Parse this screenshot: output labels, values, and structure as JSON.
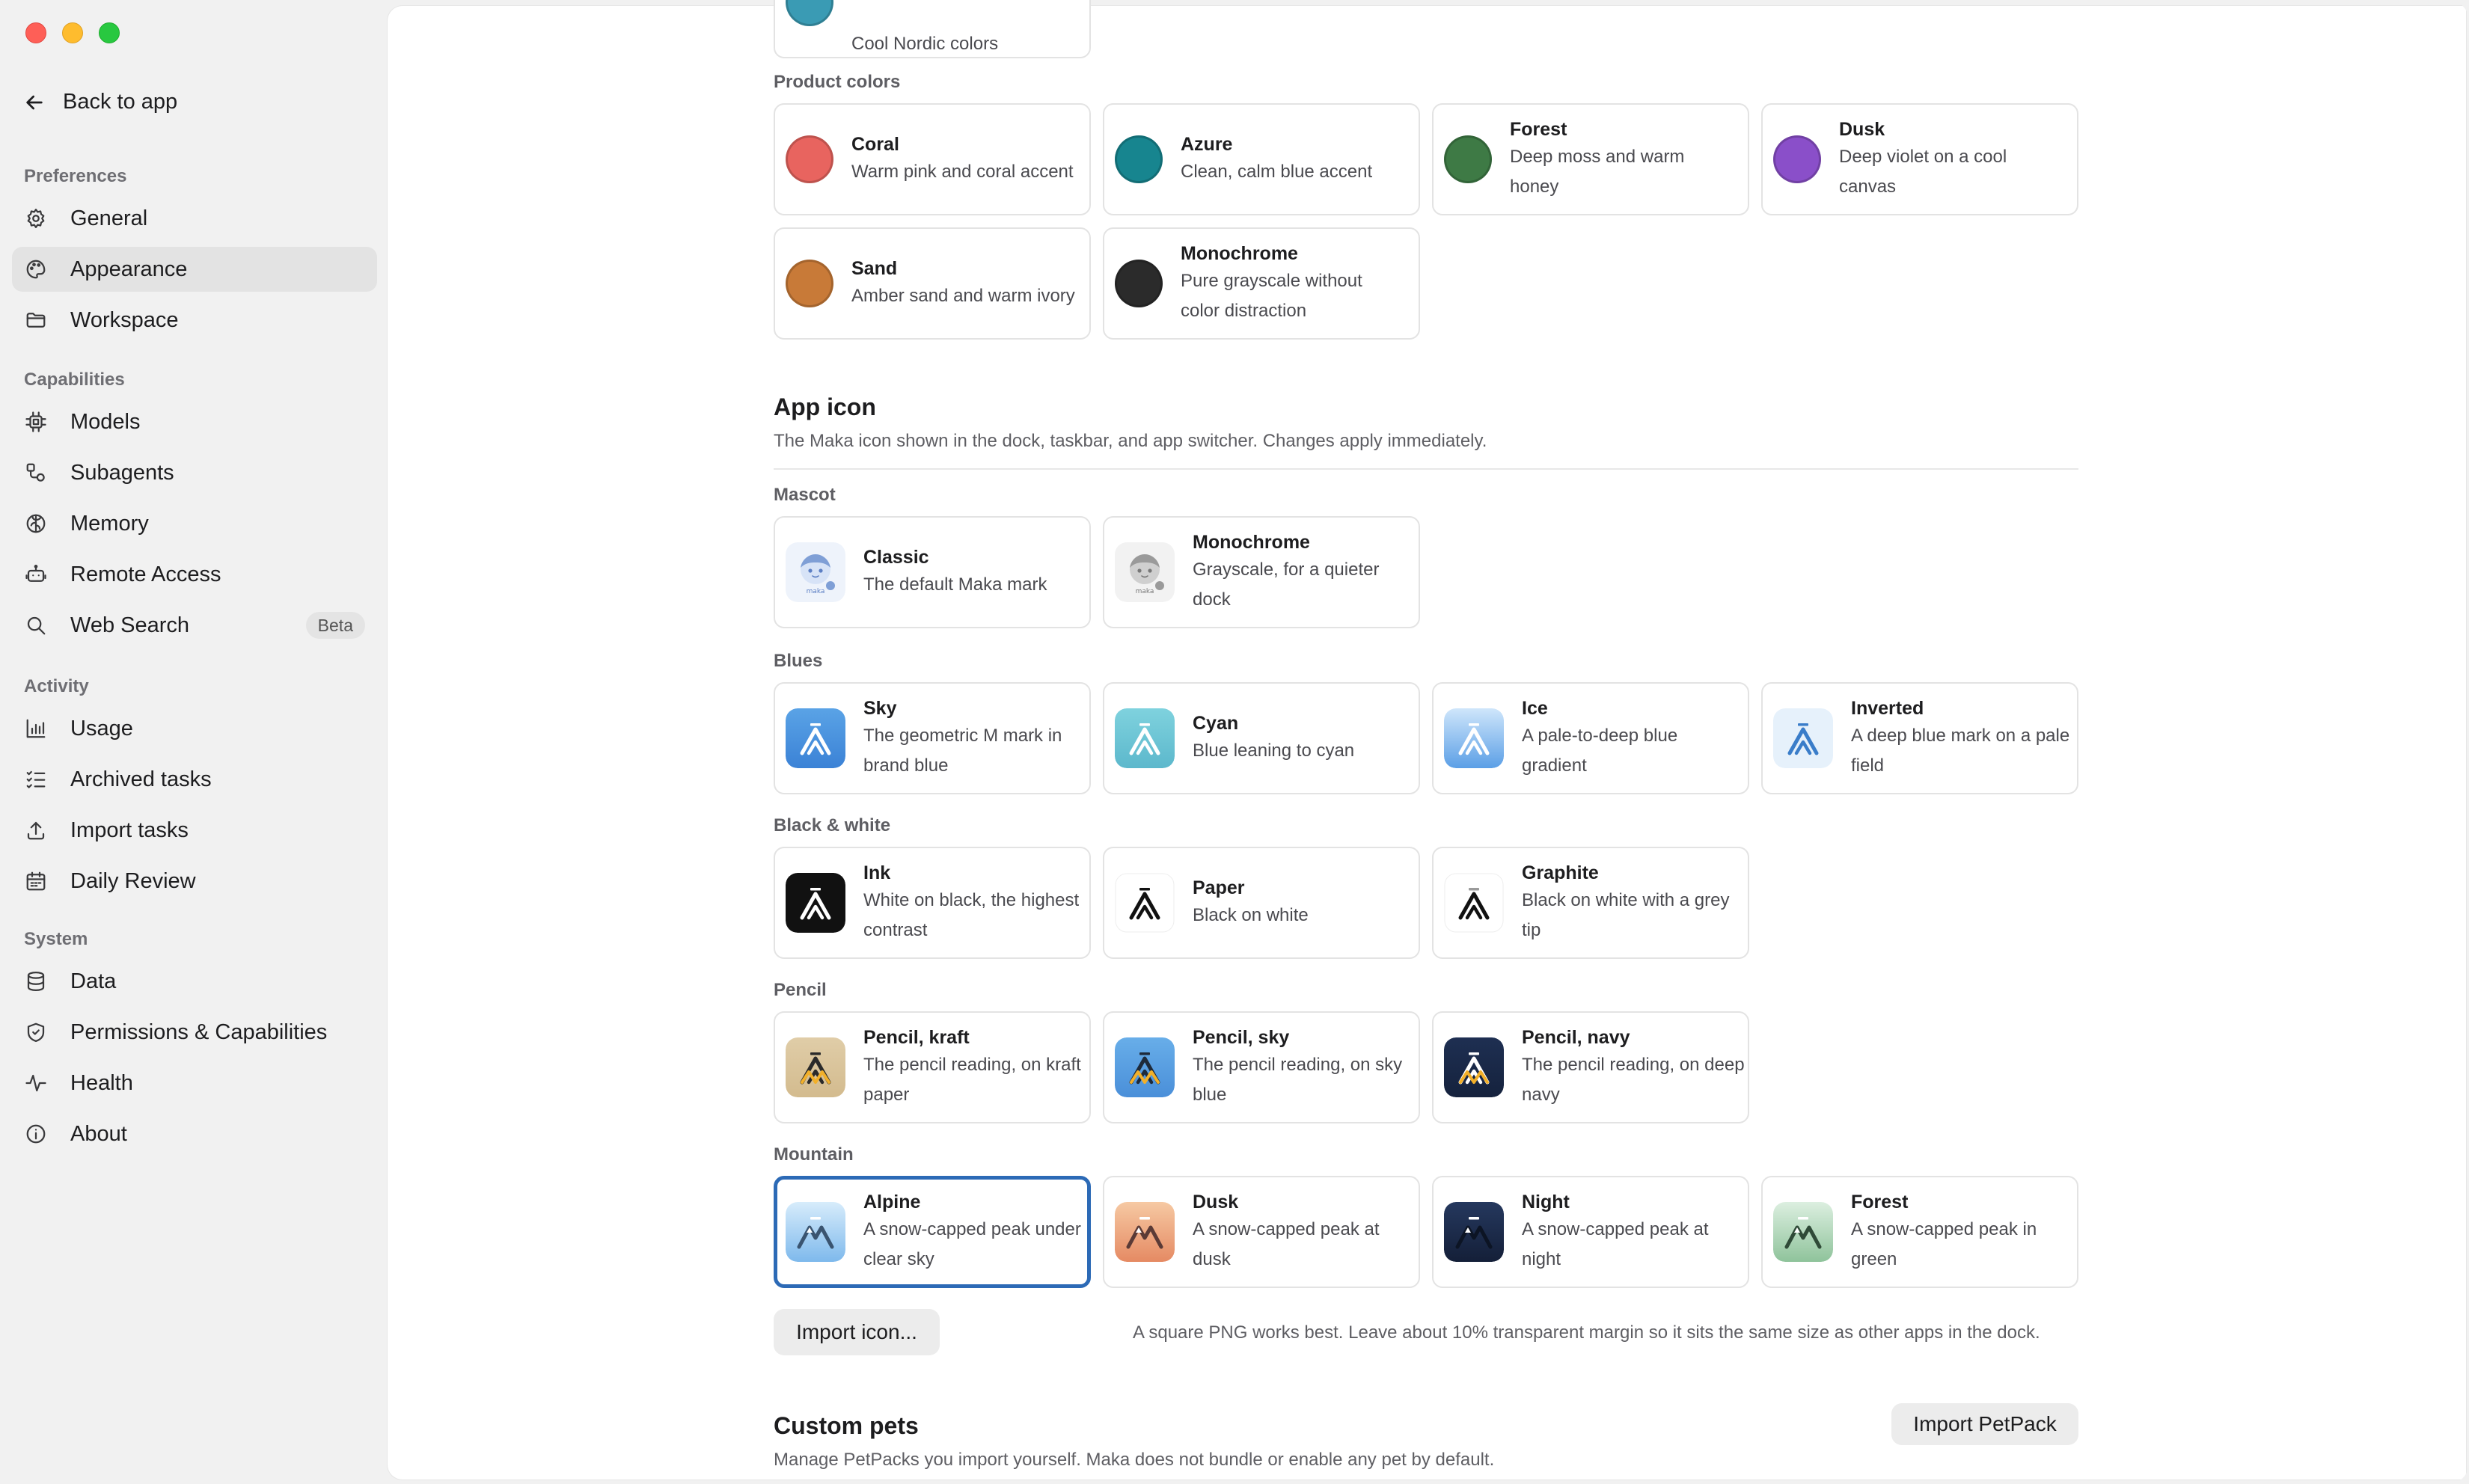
{
  "sidebar": {
    "back_label": "Back to app",
    "groups": [
      {
        "title": "Preferences",
        "items": [
          {
            "label": "General",
            "icon": "gear-icon"
          },
          {
            "label": "Appearance",
            "icon": "palette-icon",
            "active": true
          },
          {
            "label": "Workspace",
            "icon": "folder-icon"
          }
        ]
      },
      {
        "title": "Capabilities",
        "items": [
          {
            "label": "Models",
            "icon": "chip-icon"
          },
          {
            "label": "Subagents",
            "icon": "subagents-icon"
          },
          {
            "label": "Memory",
            "icon": "brain-icon"
          },
          {
            "label": "Remote Access",
            "icon": "robot-icon"
          },
          {
            "label": "Web Search",
            "icon": "search-icon",
            "badge": "Beta"
          }
        ]
      },
      {
        "title": "Activity",
        "items": [
          {
            "label": "Usage",
            "icon": "bar-chart-icon"
          },
          {
            "label": "Archived tasks",
            "icon": "checklist-icon"
          },
          {
            "label": "Import tasks",
            "icon": "upload-icon"
          },
          {
            "label": "Daily Review",
            "icon": "calendar-icon"
          }
        ]
      },
      {
        "title": "System",
        "items": [
          {
            "label": "Data",
            "icon": "database-icon"
          },
          {
            "label": "Permissions & Capabilities",
            "icon": "shield-icon"
          },
          {
            "label": "Health",
            "icon": "pulse-icon"
          },
          {
            "label": "About",
            "icon": "info-icon"
          }
        ]
      }
    ]
  },
  "content": {
    "top_partial": {
      "desc": "Cool Nordic colors",
      "color": "#3a9bb4"
    },
    "product_colors": {
      "label": "Product colors",
      "items": [
        {
          "title": "Coral",
          "desc": "Warm pink and coral accent",
          "color": "#e8645f"
        },
        {
          "title": "Azure",
          "desc": "Clean, calm blue accent",
          "color": "#17858f"
        },
        {
          "title": "Forest",
          "desc": "Deep moss and warm honey",
          "color": "#3e7a45"
        },
        {
          "title": "Dusk",
          "desc": "Deep violet on a cool canvas",
          "color": "#8a4fc9"
        },
        {
          "title": "Sand",
          "desc": "Amber sand and warm ivory",
          "color": "#c87a38"
        },
        {
          "title": "Monochrome",
          "desc": "Pure grayscale without color distraction",
          "color": "#2b2b2b"
        }
      ]
    },
    "app_icon": {
      "title": "App icon",
      "desc": "The Maka icon shown in the dock, taskbar, and app switcher. Changes apply immediately.",
      "groups": [
        {
          "label": "Mascot",
          "items": [
            {
              "title": "Classic",
              "desc": "The default Maka mark",
              "style": "mascot-color"
            },
            {
              "title": "Monochrome",
              "desc": "Grayscale, for a quieter dock",
              "style": "mascot-gray"
            }
          ]
        },
        {
          "label": "Blues",
          "items": [
            {
              "title": "Sky",
              "desc": "The geometric M mark in brand blue",
              "style": "sky"
            },
            {
              "title": "Cyan",
              "desc": "Blue leaning to cyan",
              "style": "cyan"
            },
            {
              "title": "Ice",
              "desc": "A pale-to-deep blue gradient",
              "style": "ice"
            },
            {
              "title": "Inverted",
              "desc": "A deep blue mark on a pale field",
              "style": "inverted"
            }
          ]
        },
        {
          "label": "Black & white",
          "items": [
            {
              "title": "Ink",
              "desc": "White on black, the highest contrast",
              "style": "ink"
            },
            {
              "title": "Paper",
              "desc": "Black on white",
              "style": "paper"
            },
            {
              "title": "Graphite",
              "desc": "Black on white with a grey tip",
              "style": "graphite"
            }
          ]
        },
        {
          "label": "Pencil",
          "items": [
            {
              "title": "Pencil, kraft",
              "desc": "The pencil reading, on kraft paper",
              "style": "pencil-kraft"
            },
            {
              "title": "Pencil, sky",
              "desc": "The pencil reading, on sky blue",
              "style": "pencil-sky"
            },
            {
              "title": "Pencil, navy",
              "desc": "The pencil reading, on deep navy",
              "style": "pencil-navy"
            }
          ]
        },
        {
          "label": "Mountain",
          "items": [
            {
              "title": "Alpine",
              "desc": "A snow-capped peak under clear sky",
              "style": "alpine",
              "selected": true
            },
            {
              "title": "Dusk",
              "desc": "A snow-capped peak at dusk",
              "style": "dusk"
            },
            {
              "title": "Night",
              "desc": "A snow-capped peak at night",
              "style": "night"
            },
            {
              "title": "Forest",
              "desc": "A snow-capped peak in green",
              "style": "forest"
            }
          ]
        }
      ],
      "import_button": "Import icon...",
      "import_hint": "A square PNG works best. Leave about 10% transparent margin so it sits the same size as other apps in the dock."
    },
    "custom_pets": {
      "title": "Custom pets",
      "desc": "Manage PetPacks you import yourself. Maka does not bundle or enable any pet by default.",
      "import_button": "Import PetPack"
    }
  }
}
